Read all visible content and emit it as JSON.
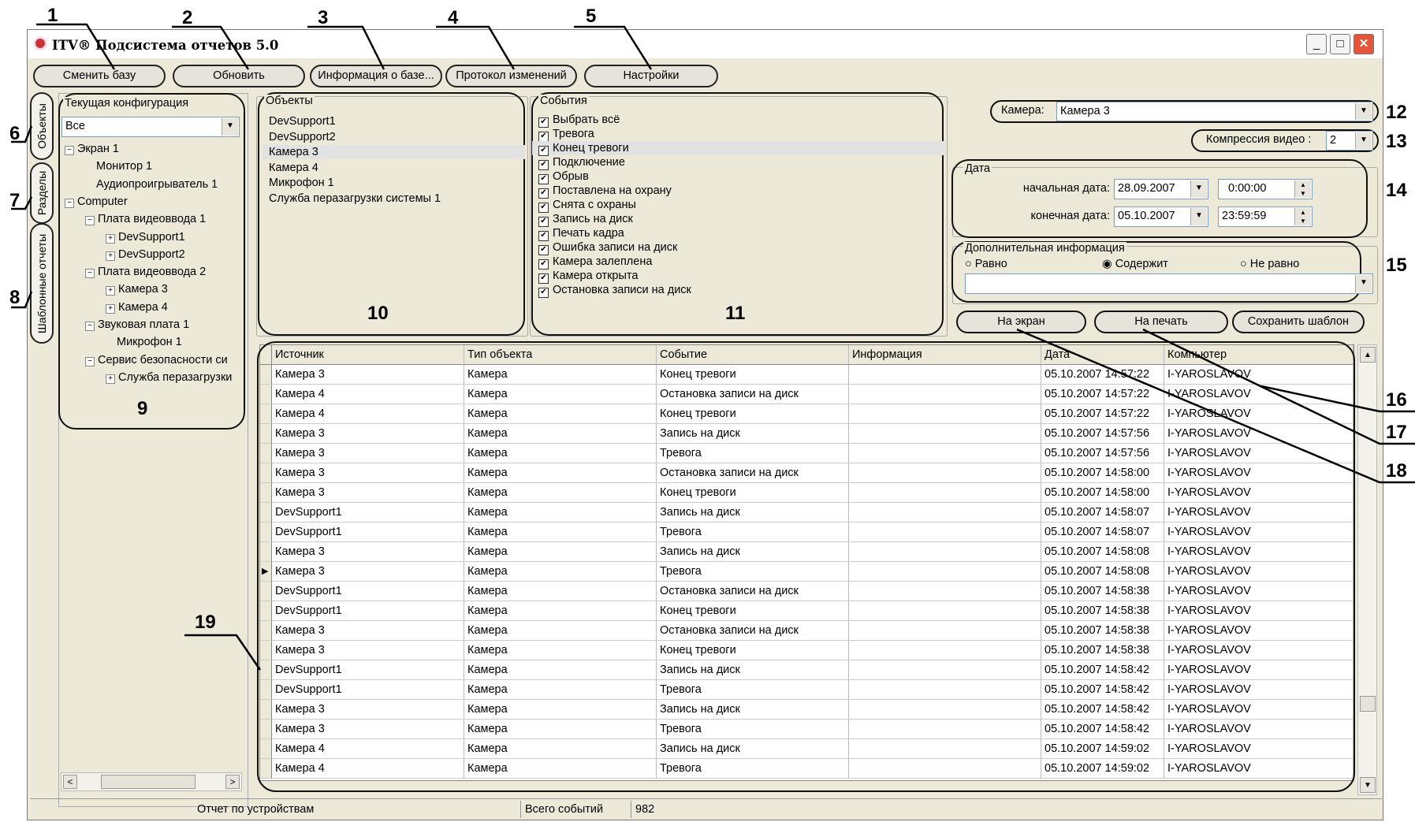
{
  "window": {
    "title": "ITV® Подсистема отчетов 5.0",
    "minimize": "_",
    "maximize": "□",
    "close": "✕"
  },
  "toolbar": {
    "change_db": "Сменить базу",
    "refresh": "Обновить",
    "db_info": "Информация о базе...",
    "changelog": "Протокол изменений",
    "settings": "Настройки"
  },
  "side_tabs": {
    "objects": "Объекты",
    "sections": "Разделы",
    "templates": "Шаблонные отчеты"
  },
  "config": {
    "label": "Текущая конфигурация",
    "filter_value": "Все",
    "tree": [
      {
        "text": "Экран 1",
        "toggle": "−"
      },
      {
        "text": "Монитор 1",
        "toggle": ""
      },
      {
        "text": "Аудиопроигрыватель 1",
        "toggle": ""
      },
      {
        "text": "Computer",
        "toggle": "−"
      },
      {
        "text": "Плата видеоввода 1",
        "toggle": "−"
      },
      {
        "text": "DevSupport1",
        "toggle": "+"
      },
      {
        "text": "DevSupport2",
        "toggle": "+"
      },
      {
        "text": "Плата видеоввода 2",
        "toggle": "−"
      },
      {
        "text": "Камера 3",
        "toggle": "+"
      },
      {
        "text": "Камера 4",
        "toggle": "+"
      },
      {
        "text": "Звуковая плата 1",
        "toggle": "−"
      },
      {
        "text": "Микрофон 1",
        "toggle": ""
      },
      {
        "text": "Сервис безопасности си",
        "toggle": "−"
      },
      {
        "text": "Служба перазагрузки",
        "toggle": "+"
      }
    ]
  },
  "objects": {
    "label": "Объекты",
    "items": [
      "DevSupport1",
      "DevSupport2",
      "Камера 3",
      "Камера 4",
      "Микрофон 1",
      "Служба перазагрузки системы 1"
    ],
    "selected_index": 2
  },
  "events": {
    "label": "События",
    "items": [
      "Выбрать всё",
      "Тревога",
      "Конец тревоги",
      "Подключение",
      "Обрыв",
      "Поставлена на охрану",
      "Снята с охраны",
      "Запись на диск",
      "Печать кадра",
      "Ошибка записи на диск",
      "Камера залеплена",
      "Камера открыта",
      "Остановка записи на диск"
    ],
    "checkmark": "✔",
    "selected_index": 2
  },
  "filters": {
    "camera_label": "Камера:",
    "camera_value": "Камера 3",
    "compression_label": "Компрессия видео :",
    "compression_value": "2",
    "date_group": "Дата",
    "start_label": "начальная дата:",
    "start_date": "28.09.2007",
    "start_time": "0:00:00",
    "end_label": "конечная дата:",
    "end_date": "05.10.2007",
    "end_time": "23:59:59",
    "extra_group": "Дополнительная информация",
    "radio_equal": "Равно",
    "radio_contains": "Содержит",
    "radio_not_equal": "Не равно",
    "selected_radio": "contains"
  },
  "actions": {
    "to_screen": "На экран",
    "to_print": "На печать",
    "save_template": "Сохранить шаблон"
  },
  "grid": {
    "columns": [
      "Источник",
      "Тип объекта",
      "Событие",
      "Информация",
      "Дата",
      "Компьютер"
    ],
    "current_row": 10,
    "rows": [
      [
        "Камера 3",
        "Камера",
        "Конец тревоги",
        "",
        "05.10.2007 14:57:22",
        "I-YAROSLAVOV"
      ],
      [
        "Камера 4",
        "Камера",
        "Остановка записи на диск",
        "",
        "05.10.2007 14:57:22",
        "I-YAROSLAVOV"
      ],
      [
        "Камера 4",
        "Камера",
        "Конец тревоги",
        "",
        "05.10.2007 14:57:22",
        "I-YAROSLAVOV"
      ],
      [
        "Камера 3",
        "Камера",
        "Запись на диск",
        "",
        "05.10.2007 14:57:56",
        "I-YAROSLAVOV"
      ],
      [
        "Камера 3",
        "Камера",
        "Тревога",
        "",
        "05.10.2007 14:57:56",
        "I-YAROSLAVOV"
      ],
      [
        "Камера 3",
        "Камера",
        "Остановка записи на диск",
        "",
        "05.10.2007 14:58:00",
        "I-YAROSLAVOV"
      ],
      [
        "Камера 3",
        "Камера",
        "Конец тревоги",
        "",
        "05.10.2007 14:58:00",
        "I-YAROSLAVOV"
      ],
      [
        "DevSupport1",
        "Камера",
        "Запись на диск",
        "",
        "05.10.2007 14:58:07",
        "I-YAROSLAVOV"
      ],
      [
        "DevSupport1",
        "Камера",
        "Тревога",
        "",
        "05.10.2007 14:58:07",
        "I-YAROSLAVOV"
      ],
      [
        "Камера 3",
        "Камера",
        "Запись на диск",
        "",
        "05.10.2007 14:58:08",
        "I-YAROSLAVOV"
      ],
      [
        "Камера 3",
        "Камера",
        "Тревога",
        "",
        "05.10.2007 14:58:08",
        "I-YAROSLAVOV"
      ],
      [
        "DevSupport1",
        "Камера",
        "Остановка записи на диск",
        "",
        "05.10.2007 14:58:38",
        "I-YAROSLAVOV"
      ],
      [
        "DevSupport1",
        "Камера",
        "Конец тревоги",
        "",
        "05.10.2007 14:58:38",
        "I-YAROSLAVOV"
      ],
      [
        "Камера 3",
        "Камера",
        "Остановка записи на диск",
        "",
        "05.10.2007 14:58:38",
        "I-YAROSLAVOV"
      ],
      [
        "Камера 3",
        "Камера",
        "Конец тревоги",
        "",
        "05.10.2007 14:58:38",
        "I-YAROSLAVOV"
      ],
      [
        "DevSupport1",
        "Камера",
        "Запись на диск",
        "",
        "05.10.2007 14:58:42",
        "I-YAROSLAVOV"
      ],
      [
        "DevSupport1",
        "Камера",
        "Тревога",
        "",
        "05.10.2007 14:58:42",
        "I-YAROSLAVOV"
      ],
      [
        "Камера 3",
        "Камера",
        "Запись на диск",
        "",
        "05.10.2007 14:58:42",
        "I-YAROSLAVOV"
      ],
      [
        "Камера 3",
        "Камера",
        "Тревога",
        "",
        "05.10.2007 14:58:42",
        "I-YAROSLAVOV"
      ],
      [
        "Камера 4",
        "Камера",
        "Запись на диск",
        "",
        "05.10.2007 14:59:02",
        "I-YAROSLAVOV"
      ],
      [
        "Камера 4",
        "Камера",
        "Тревога",
        "",
        "05.10.2007 14:59:02",
        "I-YAROSLAVOV"
      ]
    ]
  },
  "status": {
    "report_type": "Отчет по устройствам",
    "total_label": "Всего событий",
    "total_value": "982"
  },
  "callouts": [
    "1",
    "2",
    "3",
    "4",
    "5",
    "6",
    "7",
    "8",
    "9",
    "10",
    "11",
    "12",
    "13",
    "14",
    "15",
    "16",
    "17",
    "18",
    "19"
  ],
  "icons": {
    "row_pointer": "▶",
    "scroll_up": "▲",
    "scroll_down": "▼",
    "scroll_left": "<",
    "scroll_right": ">",
    "dropdown": "▼",
    "spin_up": "▲",
    "spin_down": "▼",
    "radio_on": "◉",
    "radio_off": "○"
  }
}
